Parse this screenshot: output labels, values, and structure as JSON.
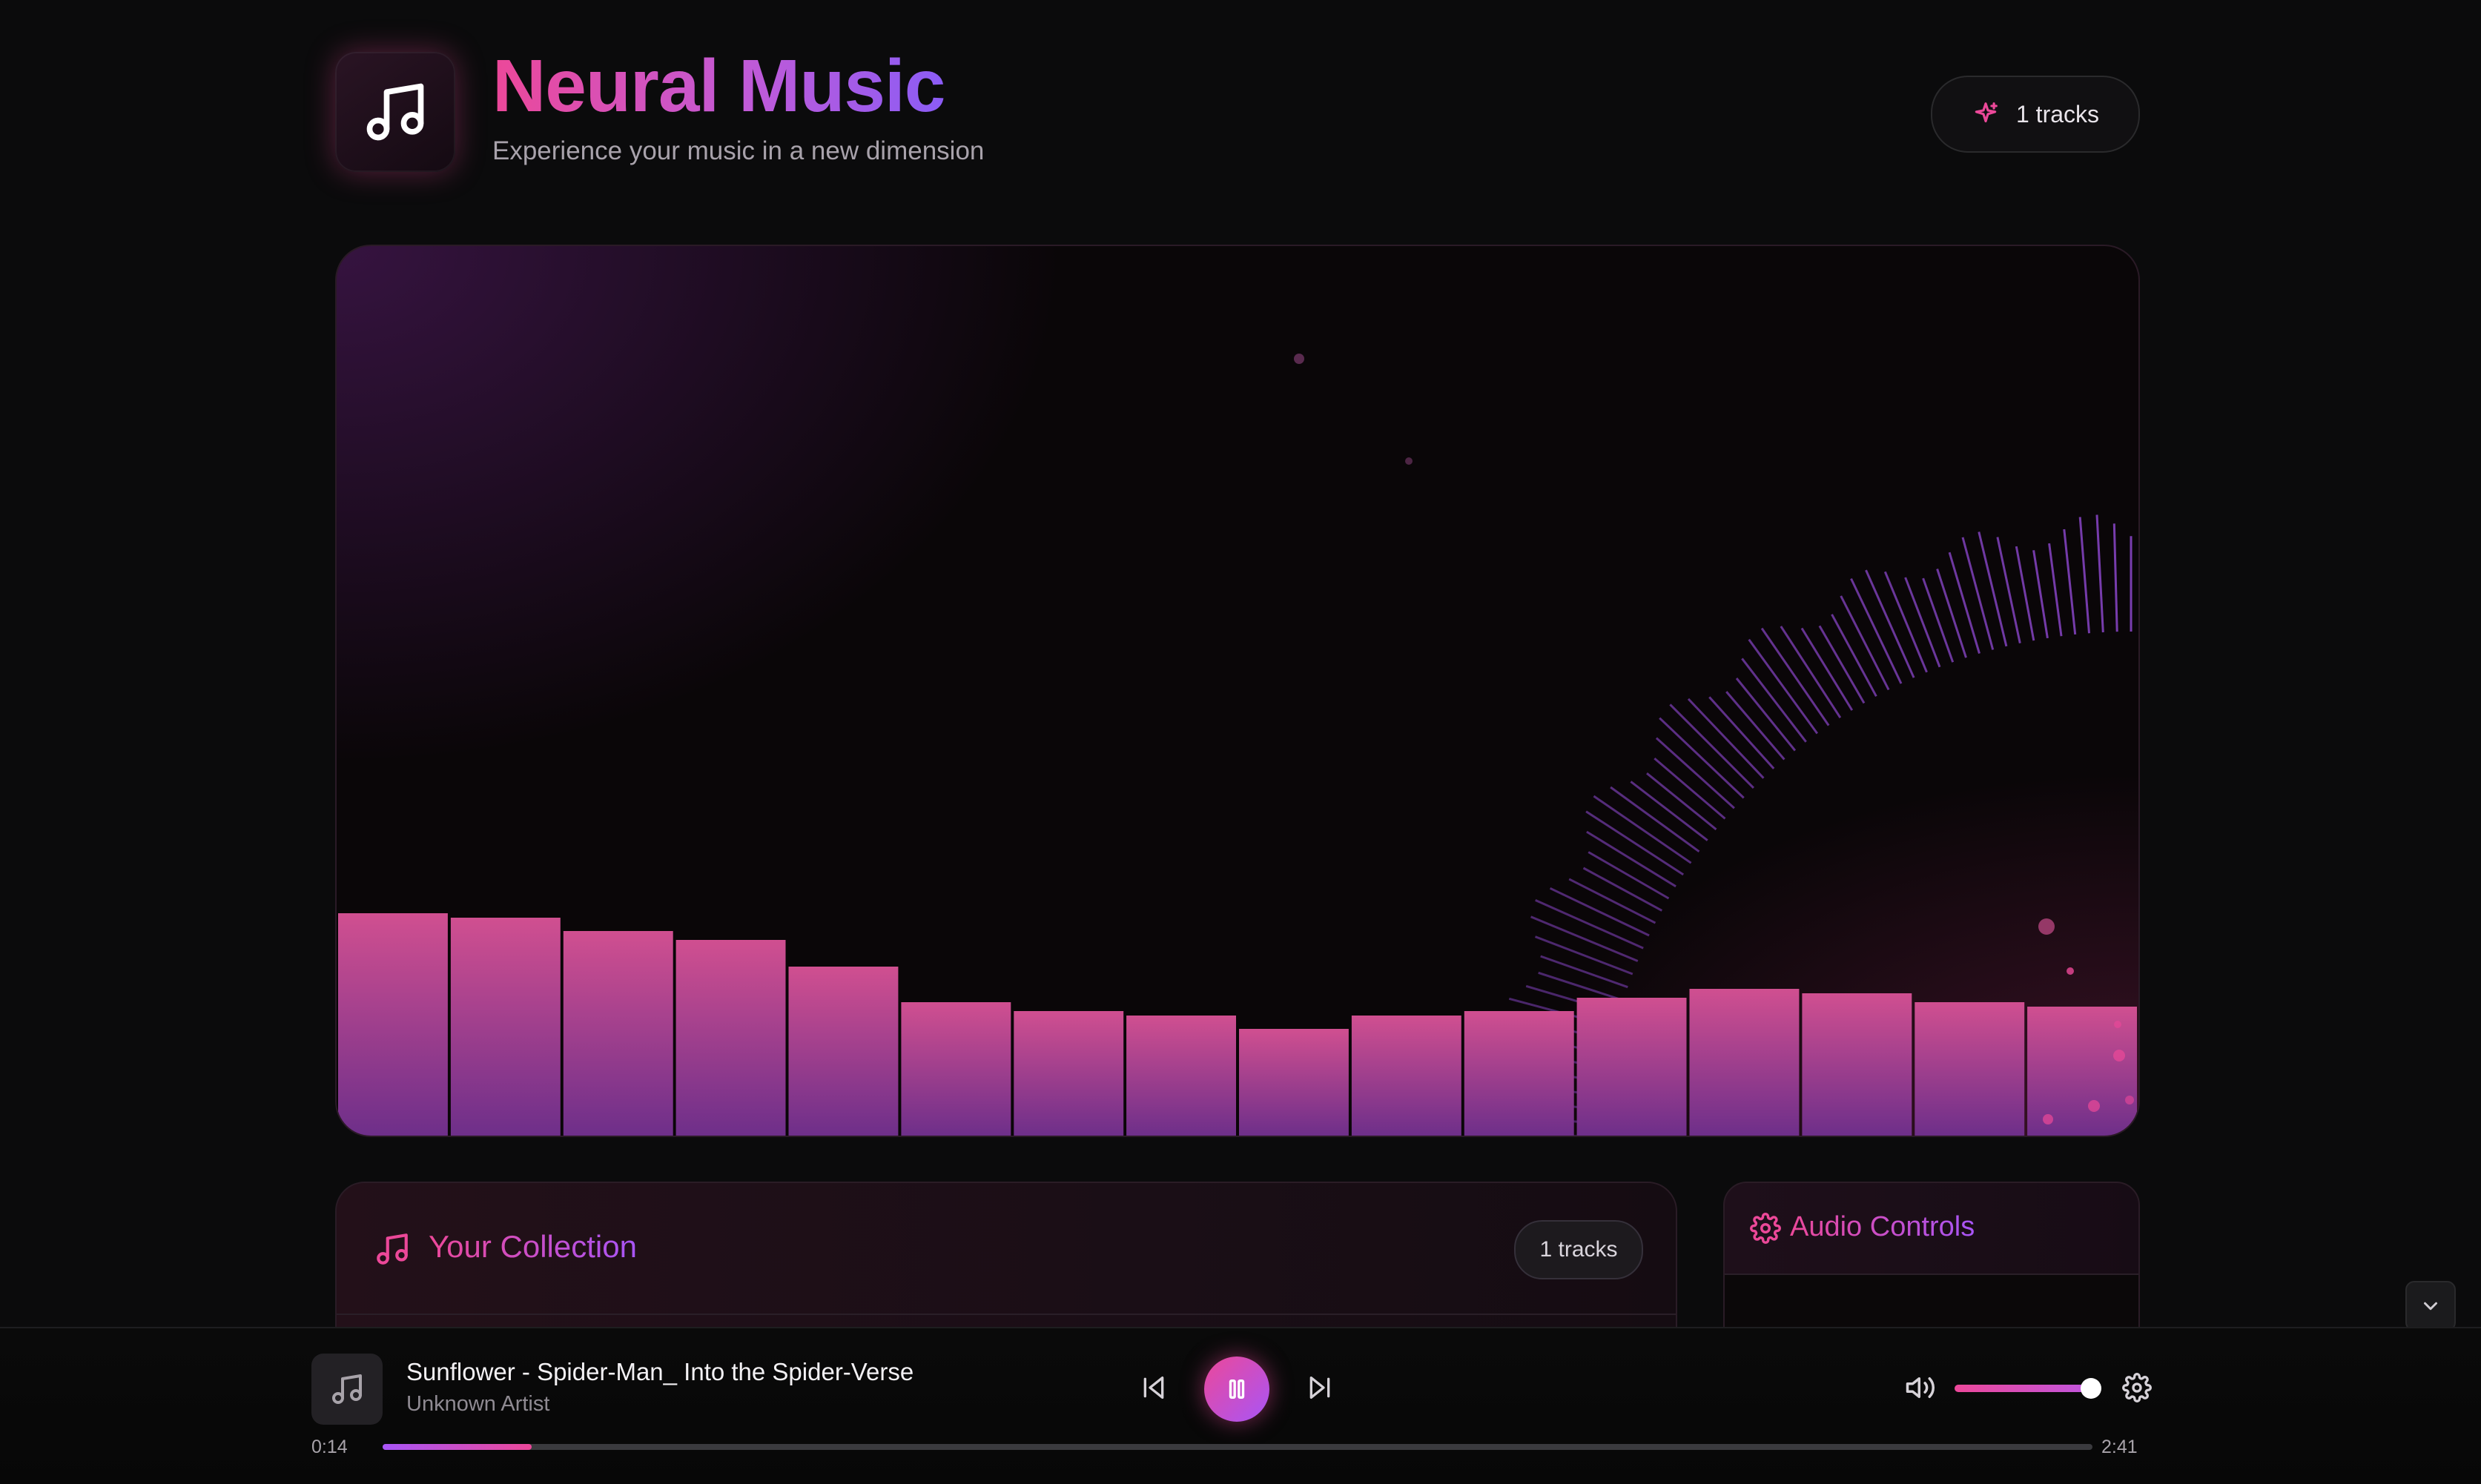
{
  "app": {
    "title": "Neural Music",
    "subtitle": "Experience your music in a new dimension",
    "tracks_badge": "1 tracks",
    "logo_icon": "music-note-icon",
    "badge_icon": "sparkles-icon"
  },
  "visualizer": {
    "bar_levels": [
      0.25,
      0.245,
      0.23,
      0.22,
      0.19,
      0.15,
      0.14,
      0.135,
      0.12,
      0.135,
      0.14,
      0.155,
      0.165,
      0.16,
      0.15,
      0.145
    ],
    "colors": {
      "bar_top": "#d04f90",
      "bar_bottom": "#6e2f8a",
      "ring": "#a855f7"
    }
  },
  "collection": {
    "title": "Your Collection",
    "count": "1 tracks",
    "icon": "music-note-icon"
  },
  "audio_controls": {
    "title": "Audio Controls",
    "icon": "gear-icon"
  },
  "player": {
    "track_title": "Sunflower - Spider-Man_ Into the Spider-Verse",
    "artist": "Unknown Artist",
    "current_time": "0:14",
    "total_time": "2:41",
    "progress": 0.087,
    "volume": 1.0,
    "state": "playing"
  },
  "colors": {
    "accent_pink": "#ec4899",
    "accent_purple": "#a855f7",
    "background": "#0b0b0c"
  }
}
